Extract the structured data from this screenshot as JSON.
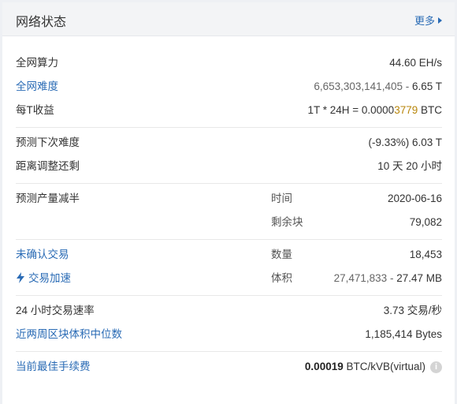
{
  "header": {
    "title": "网络状态",
    "more_label": "更多"
  },
  "stats": {
    "hashrate": {
      "label": "全网算力",
      "value": "44.60 EH/s"
    },
    "difficulty": {
      "label": "全网难度",
      "value_main": "6,653,303,141,405",
      "value_sep": " - ",
      "value_short": "6.65 T"
    },
    "reward": {
      "label": "每T收益",
      "value_prefix": "1T * 24H = 0.0000",
      "value_highlight": "3779",
      "value_unit": " BTC"
    },
    "next_difficulty": {
      "label": "预测下次难度",
      "value_change": "(-9.33%)",
      "value_diff": " 6.03 T"
    },
    "time_to_adjust": {
      "label": "距离调整还剩",
      "value": "10 天 20 小时"
    },
    "halving": {
      "label": "预测产量减半",
      "time_label": "时间",
      "time_value": "2020-06-16",
      "blocks_label": "剩余块",
      "blocks_value": "79,082"
    },
    "unconfirmed": {
      "label": "未确认交易",
      "count_label": "数量",
      "count_value": "18,453"
    },
    "accelerate": {
      "label": "交易加速",
      "size_label": "体积",
      "size_main": "27,471,833",
      "size_sep": " - ",
      "size_short": "27.47 MB"
    },
    "tx_rate": {
      "label": "24 小时交易速率",
      "value": "3.73 交易/秒"
    },
    "median_block": {
      "label": "近两周区块体积中位数",
      "value": "1,185,414 Bytes"
    },
    "best_fee": {
      "label": "当前最佳手续费",
      "value_bold": "0.00019",
      "value_unit": " BTC/kVB(virtual)",
      "info_icon": "i"
    }
  },
  "colors": {
    "link": "#2a6bb5",
    "accent": "#f0a500"
  }
}
